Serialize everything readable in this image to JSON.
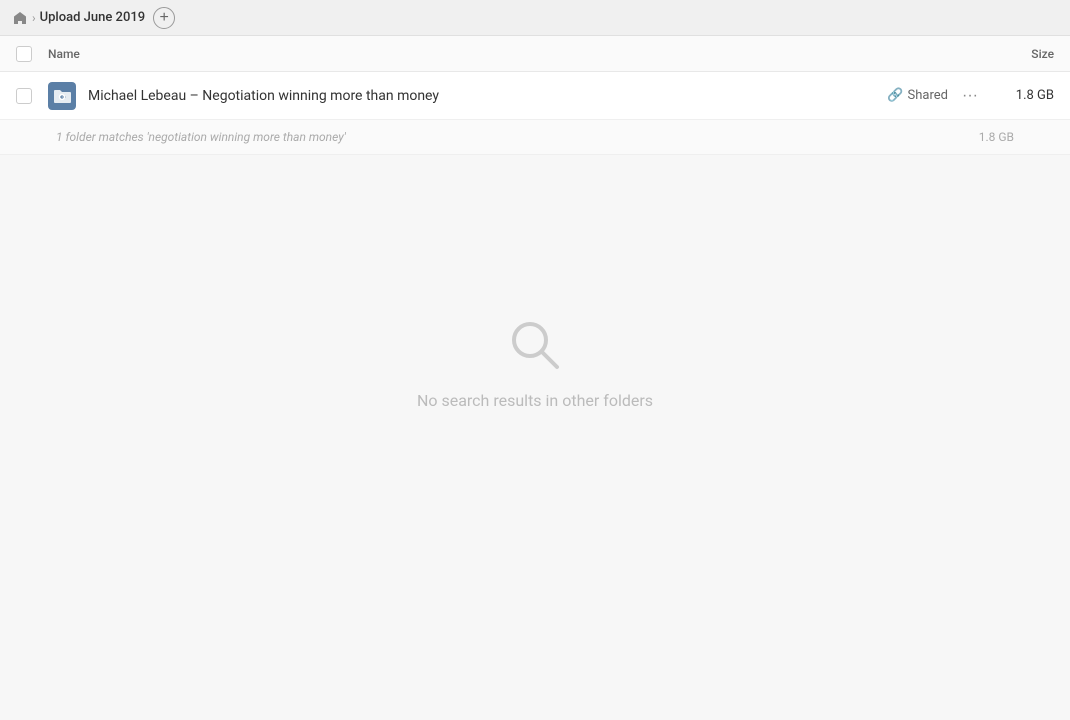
{
  "breadcrumb": {
    "home_icon": "home-icon",
    "title": "Upload June 2019",
    "add_button_label": "+"
  },
  "table": {
    "name_header": "Name",
    "size_header": "Size"
  },
  "file_row": {
    "icon_label": "folder-link-icon",
    "name": "Michael Lebeau – Negotiation winning more than money",
    "shared_label": "Shared",
    "more_label": "···",
    "size": "1.8 GB"
  },
  "match_row": {
    "text": "1 folder matches 'negotiation winning more than money'",
    "size": "1.8 GB"
  },
  "no_results": {
    "search_icon": "search-icon",
    "text": "No search results in other folders"
  }
}
